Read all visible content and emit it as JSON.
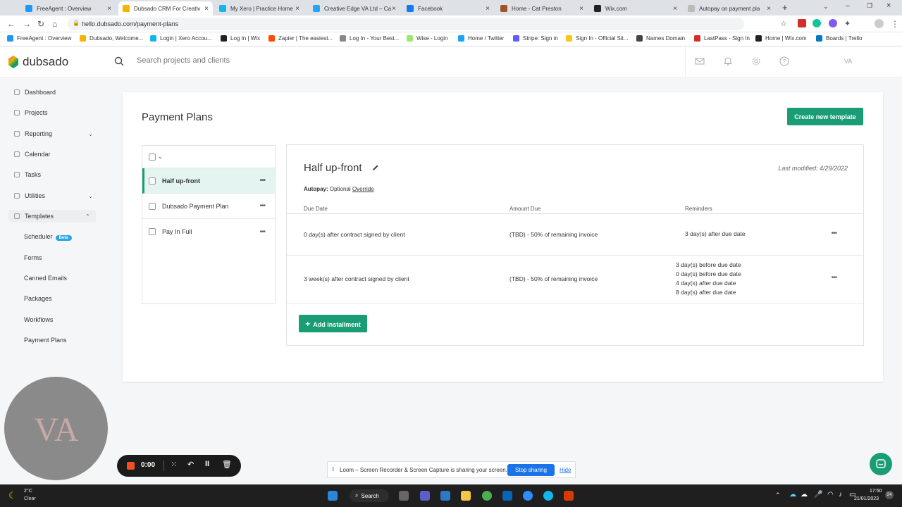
{
  "browser": {
    "tabs": [
      {
        "label": "FreeAgent : Overview",
        "color": "#2196f3"
      },
      {
        "label": "Dubsado CRM For Creativ",
        "color": "#f4b400"
      },
      {
        "label": "My Xero | Practice Home",
        "color": "#13b5ea"
      },
      {
        "label": "Creative Edge VA Ltd – Ca",
        "color": "#29a3ff"
      },
      {
        "label": "Facebook",
        "color": "#1877f2"
      },
      {
        "label": "Home - Cat Preston",
        "color": "#a0522d"
      },
      {
        "label": "Wix.com",
        "color": "#222"
      },
      {
        "label": "Autopay on payment pla",
        "color": "#bbb"
      }
    ],
    "url": "hello.dubsado.com/payment-plans",
    "bookmarks": [
      {
        "label": "FreeAgent : Overview",
        "color": "#2196f3"
      },
      {
        "label": "Dubsado, Welcome...",
        "color": "#f4b400"
      },
      {
        "label": "Login | Xero Accou...",
        "color": "#13b5ea"
      },
      {
        "label": "Log In | Wix",
        "color": "#222"
      },
      {
        "label": "Zapier | The easiest...",
        "color": "#ff4a00"
      },
      {
        "label": "Log In - Your Best...",
        "color": "#888"
      },
      {
        "label": "Wise - Login",
        "color": "#9fe870"
      },
      {
        "label": "Home / Twitter",
        "color": "#1da1f2"
      },
      {
        "label": "Stripe: Sign in",
        "color": "#635bff"
      },
      {
        "label": "Sign In - Official Sit...",
        "color": "#f5c518"
      },
      {
        "label": "Names Domain",
        "color": "#444"
      },
      {
        "label": "LastPass - Sign In",
        "color": "#d32d27"
      },
      {
        "label": "Home | Wix.com",
        "color": "#222"
      },
      {
        "label": "Boards | Trello",
        "color": "#0079bf"
      }
    ]
  },
  "header": {
    "logo": "dubsado",
    "search_placeholder": "Search projects and clients",
    "avatar": "VA"
  },
  "sidebar": {
    "items": [
      "Dashboard",
      "Projects",
      "Reporting",
      "Calendar",
      "Tasks",
      "Utilities",
      "Templates"
    ],
    "templates_sub": [
      "Scheduler",
      "Forms",
      "Canned Emails",
      "Packages",
      "Workflows",
      "Payment Plans"
    ],
    "beta": "Beta"
  },
  "main": {
    "title": "Payment Plans",
    "create_label": "Create new template",
    "plans": [
      "Half up-front",
      "Dubsado Payment Plan",
      "Pay In Full"
    ]
  },
  "detail": {
    "name": "Half up-front",
    "modified": "Last modified: 4/29/2022",
    "autopay_label": "Autopay:",
    "autopay_value": "Optional",
    "override": "Override",
    "col_due": "Due Date",
    "col_amount": "Amount Due",
    "col_reminders": "Reminders",
    "rows": [
      {
        "due": "0 day(s) after contract signed by client",
        "amount": "(TBD) - 50% of remaining invoice",
        "reminders": [
          "3 day(s) after due date"
        ]
      },
      {
        "due": "3 week(s) after contract signed by client",
        "amount": "(TBD) - 50% of remaining invoice",
        "reminders": [
          "3 day(s) before due date",
          "0 day(s) before due date",
          "4 day(s) after due date",
          "8 day(s) after due date"
        ]
      }
    ],
    "add_label": "Add installment"
  },
  "loom": {
    "timer": "0:00",
    "share_text": "Loom – Screen Recorder & Screen Capture is sharing your screen.",
    "stop_label": "Stop sharing",
    "hide_label": "Hide"
  },
  "taskbar": {
    "temp": "2°C",
    "weather": "Clear",
    "search": "Search",
    "time": "17:50",
    "date": "21/01/2023",
    "badge": "24"
  }
}
